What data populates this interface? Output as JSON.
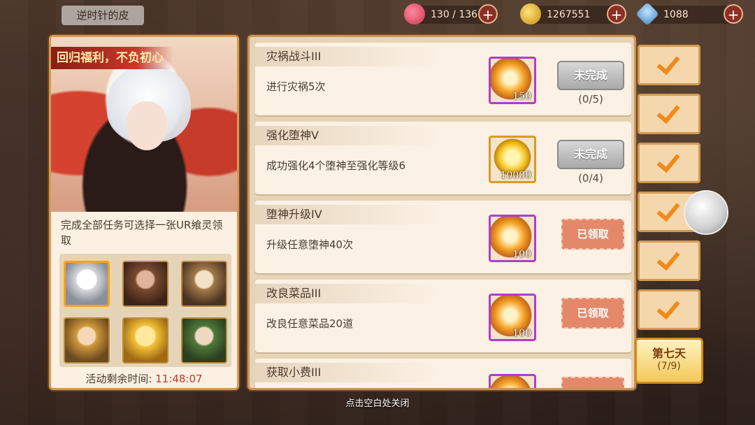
{
  "player": {
    "name": "逆时针的皮"
  },
  "resources": [
    {
      "icon": "heart-icon",
      "value": "130 / 136"
    },
    {
      "icon": "gold-coin-icon",
      "value": "1267551"
    },
    {
      "icon": "diamond-icon",
      "value": "1088"
    }
  ],
  "left_panel": {
    "banner": "回归福利，不负初心",
    "description": "完成全部任务可选择一张UR飨灵领取",
    "timer_label": "活动剩余时间:",
    "timer_value": "11:48:07"
  },
  "tasks": [
    {
      "title": "灾祸战斗III",
      "desc": "进行灾祸5次",
      "reward_qty": "150",
      "status": "未完成",
      "progress": "(0/5)"
    },
    {
      "title": "强化堕神V",
      "desc": "成功强化4个堕神至强化等级6",
      "reward_qty": "10000",
      "status": "未完成",
      "progress": "(0/4)"
    },
    {
      "title": "堕神升级IV",
      "desc": "升级任意堕神40次",
      "reward_qty": "100",
      "status": "已领取"
    },
    {
      "title": "改良菜品III",
      "desc": "改良任意菜品20道",
      "reward_qty": "100",
      "status": "已领取"
    },
    {
      "title": "获取小费III"
    }
  ],
  "day_tab": {
    "label": "第七天",
    "progress": "(7/9)"
  },
  "close_hint": "点击空白处关闭",
  "colors": {
    "accent": "#f08a1a",
    "claimed": "#e4886a",
    "timer": "#c0392b"
  }
}
